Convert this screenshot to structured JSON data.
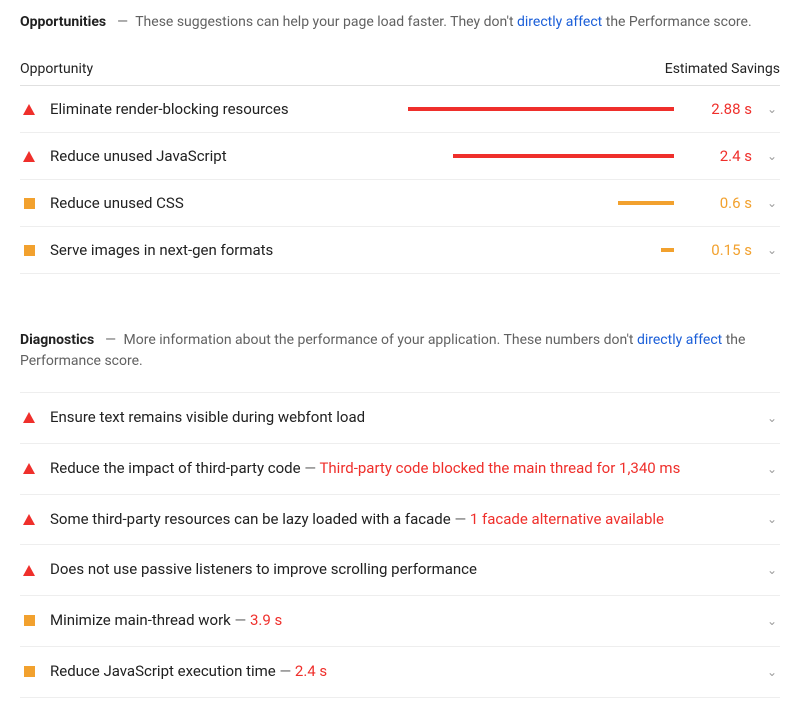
{
  "opportunities": {
    "title": "Opportunities",
    "desc_prefix": "These suggestions can help your page load faster. They don't ",
    "desc_link": "directly affect",
    "desc_suffix": " the Performance score.",
    "col_left": "Opportunity",
    "col_right": "Estimated Savings",
    "items": [
      {
        "severity": "red",
        "label": "Eliminate render-blocking resources",
        "savings": "2.88 s",
        "bar_pct": 100
      },
      {
        "severity": "red",
        "label": "Reduce unused JavaScript",
        "savings": "2.4 s",
        "bar_pct": 83
      },
      {
        "severity": "orange",
        "label": "Reduce unused CSS",
        "savings": "0.6 s",
        "bar_pct": 21
      },
      {
        "severity": "orange",
        "label": "Serve images in next-gen formats",
        "savings": "0.15 s",
        "bar_pct": 5
      }
    ]
  },
  "diagnostics": {
    "title": "Diagnostics",
    "desc_prefix": "More information about the performance of your application. These numbers don't ",
    "desc_link": "directly affect",
    "desc_suffix": " the Performance score.",
    "items": [
      {
        "severity": "red",
        "label": "Ensure text remains visible during webfont load",
        "detail": ""
      },
      {
        "severity": "red",
        "label": "Reduce the impact of third-party code",
        "detail": "Third-party code blocked the main thread for 1,340 ms"
      },
      {
        "severity": "red",
        "label": "Some third-party resources can be lazy loaded with a facade",
        "detail": "1 facade alternative available"
      },
      {
        "severity": "red",
        "label": "Does not use passive listeners to improve scrolling performance",
        "detail": ""
      },
      {
        "severity": "orange",
        "label": "Minimize main-thread work",
        "detail": "3.9 s"
      },
      {
        "severity": "orange",
        "label": "Reduce JavaScript execution time",
        "detail": "2.4 s"
      }
    ]
  },
  "glyphs": {
    "dash": "—",
    "chevron": "⌄"
  }
}
